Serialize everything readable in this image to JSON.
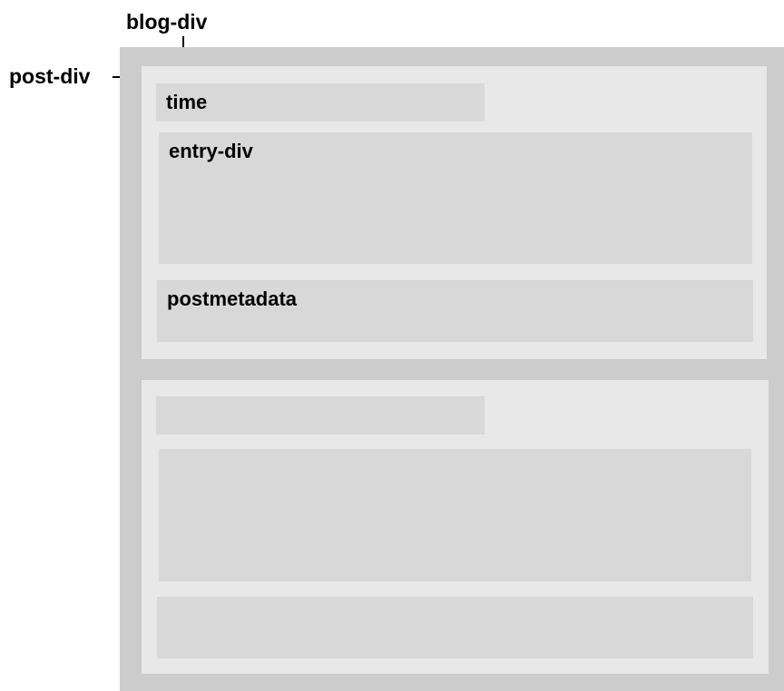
{
  "labels": {
    "blog_div": "blog-div",
    "post_div": "post-div"
  },
  "posts": [
    {
      "time_label": "time",
      "entry_label": "entry-div",
      "postmetadata_label": "postmetadata"
    },
    {
      "time_label": "",
      "entry_label": "",
      "postmetadata_label": ""
    }
  ],
  "colors": {
    "blog_div_fill": "#cccccc",
    "post_div_fill": "#e8e8e8",
    "inner_block_fill": "#d8d8d8",
    "text": "#000000"
  }
}
